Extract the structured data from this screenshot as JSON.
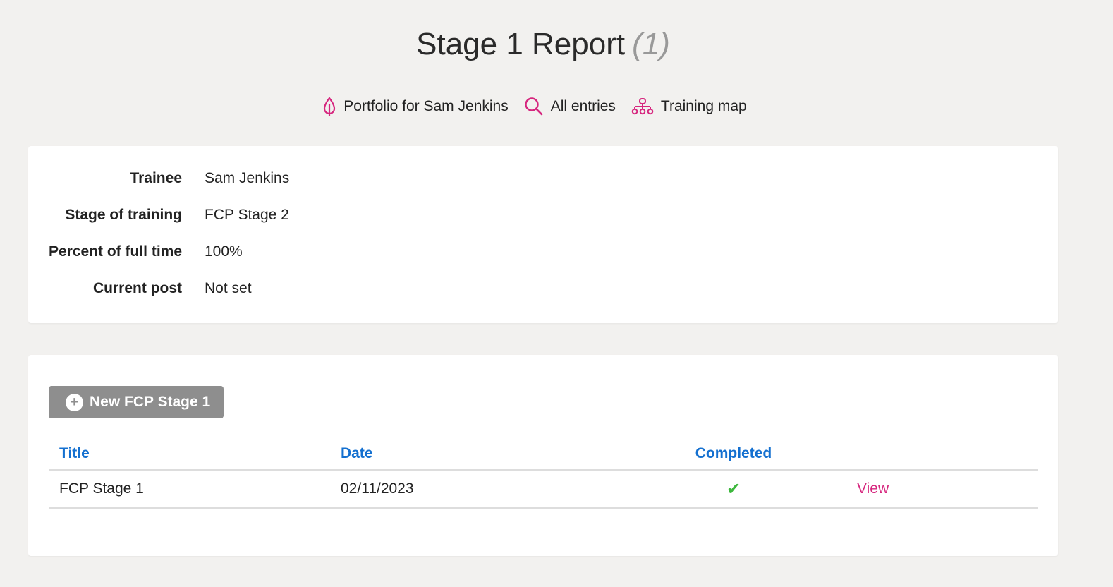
{
  "header": {
    "title": "Stage 1 Report",
    "count": "(1)"
  },
  "nav": [
    {
      "label": "Portfolio for Sam Jenkins",
      "icon": "leaf-icon"
    },
    {
      "label": "All entries",
      "icon": "search-icon"
    },
    {
      "label": "Training map",
      "icon": "sitemap-icon"
    }
  ],
  "details": [
    {
      "label": "Trainee",
      "value": "Sam Jenkins"
    },
    {
      "label": "Stage of training",
      "value": "FCP Stage 2"
    },
    {
      "label": "Percent of full time",
      "value": "100%"
    },
    {
      "label": "Current post",
      "value": "Not set"
    }
  ],
  "new_button": {
    "label": "New FCP Stage 1",
    "icon": "plus-circle-icon"
  },
  "table": {
    "headers": [
      "Title",
      "Date",
      "Completed"
    ],
    "rows": [
      {
        "title": "FCP Stage 1",
        "date": "02/11/2023",
        "completed": "✔",
        "action": "View"
      }
    ]
  },
  "colors": {
    "accent_pink": "#d6267e",
    "link_blue": "#1470d0",
    "check_green": "#3db83d",
    "button_gray": "#8e8e8e",
    "background": "#f2f1ef"
  }
}
